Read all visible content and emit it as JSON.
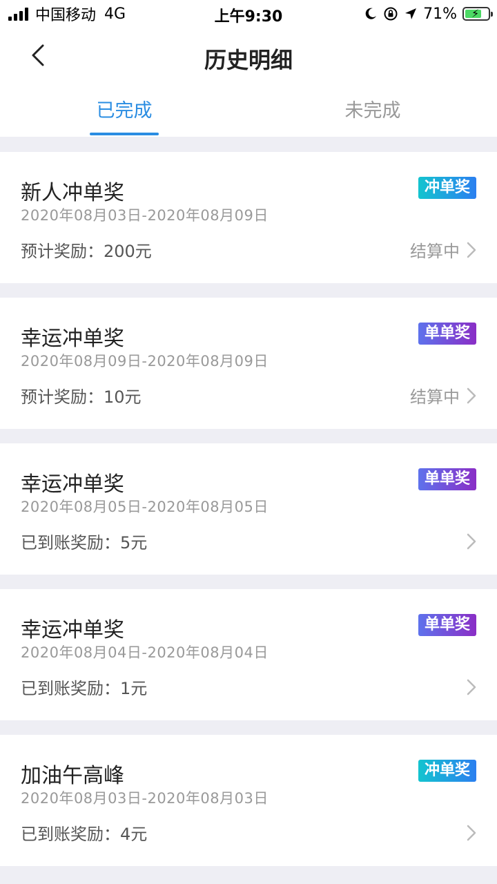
{
  "status_bar": {
    "carrier": "中国移动",
    "network": "4G",
    "time": "上午9:30",
    "battery_percent": "71%",
    "battery_level": 0.71
  },
  "nav": {
    "title": "历史明细"
  },
  "tabs": [
    {
      "label": "已完成",
      "active": true
    },
    {
      "label": "未完成",
      "active": false
    }
  ],
  "colors": {
    "accent": "#2a8de2",
    "badge_teal": "#14c4cf",
    "badge_purple": "#8a2ec6",
    "battery_green": "#4cd964"
  },
  "cards": [
    {
      "title": "新人冲单奖",
      "badge": "冲单奖",
      "badge_style": "teal",
      "date": "2020年08月03日-2020年08月09日",
      "reward": "预计奖励：200元",
      "status": "结算中"
    },
    {
      "title": "幸运冲单奖",
      "badge": "单单奖",
      "badge_style": "purple",
      "date": "2020年08月09日-2020年08月09日",
      "reward": "预计奖励：10元",
      "status": "结算中"
    },
    {
      "title": "幸运冲单奖",
      "badge": "单单奖",
      "badge_style": "purple",
      "date": "2020年08月05日-2020年08月05日",
      "reward": "已到账奖励：5元",
      "status": ""
    },
    {
      "title": "幸运冲单奖",
      "badge": "单单奖",
      "badge_style": "purple",
      "date": "2020年08月04日-2020年08月04日",
      "reward": "已到账奖励：1元",
      "status": ""
    },
    {
      "title": "加油午高峰",
      "badge": "冲单奖",
      "badge_style": "teal",
      "date": "2020年08月03日-2020年08月03日",
      "reward": "已到账奖励：4元",
      "status": ""
    }
  ]
}
